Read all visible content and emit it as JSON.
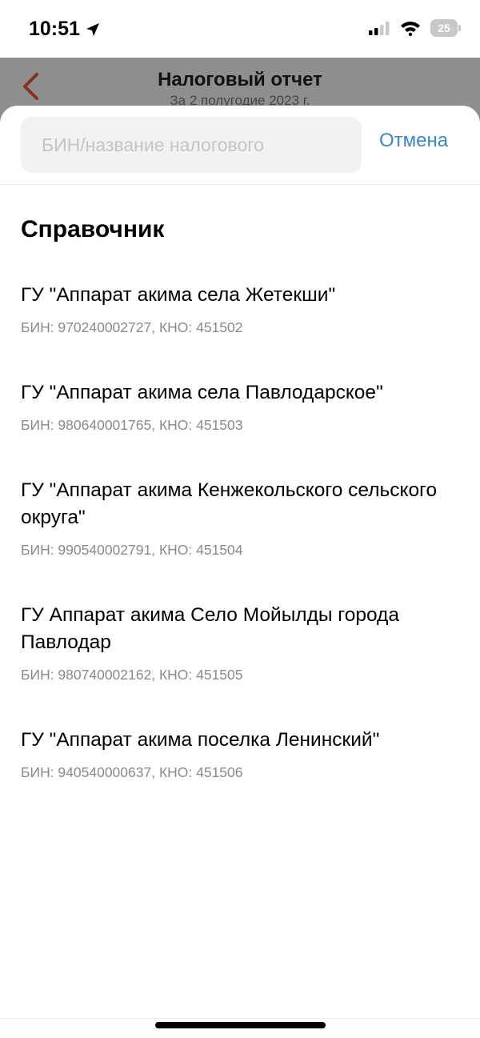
{
  "status_bar": {
    "time": "10:51",
    "battery": "25",
    "icons": [
      "location-arrow-icon",
      "signal-icon",
      "wifi-icon",
      "battery-icon"
    ]
  },
  "background_screen": {
    "title": "Налоговый отчет",
    "subtitle": "За 2 полугодие 2023 г.",
    "back_icon": "chevron-left-icon",
    "accent_color": "#a13a2a"
  },
  "search": {
    "placeholder": "БИН/название налогового",
    "value": "",
    "cancel_label": "Отмена",
    "cancel_color": "#3a87c8"
  },
  "directory": {
    "title": "Справочник",
    "items": [
      {
        "name": "ГУ \"Аппарат акима села Жетекши\"",
        "details": "БИН: 970240002727, КНО: 451502"
      },
      {
        "name": "ГУ \"Аппарат акима села Павлодарское\"",
        "details": "БИН: 980640001765, КНО: 451503"
      },
      {
        "name": "ГУ \"Аппарат акима Кенжекольского сельского округа\"",
        "details": "БИН: 990540002791, КНО: 451504"
      },
      {
        "name": "ГУ Аппарат акима Село Мойылды города Павлодар",
        "details": "БИН: 980740002162, КНО: 451505"
      },
      {
        "name": "ГУ \"Аппарат акима поселка Ленинский\"",
        "details": "БИН: 940540000637, КНО: 451506"
      }
    ]
  }
}
